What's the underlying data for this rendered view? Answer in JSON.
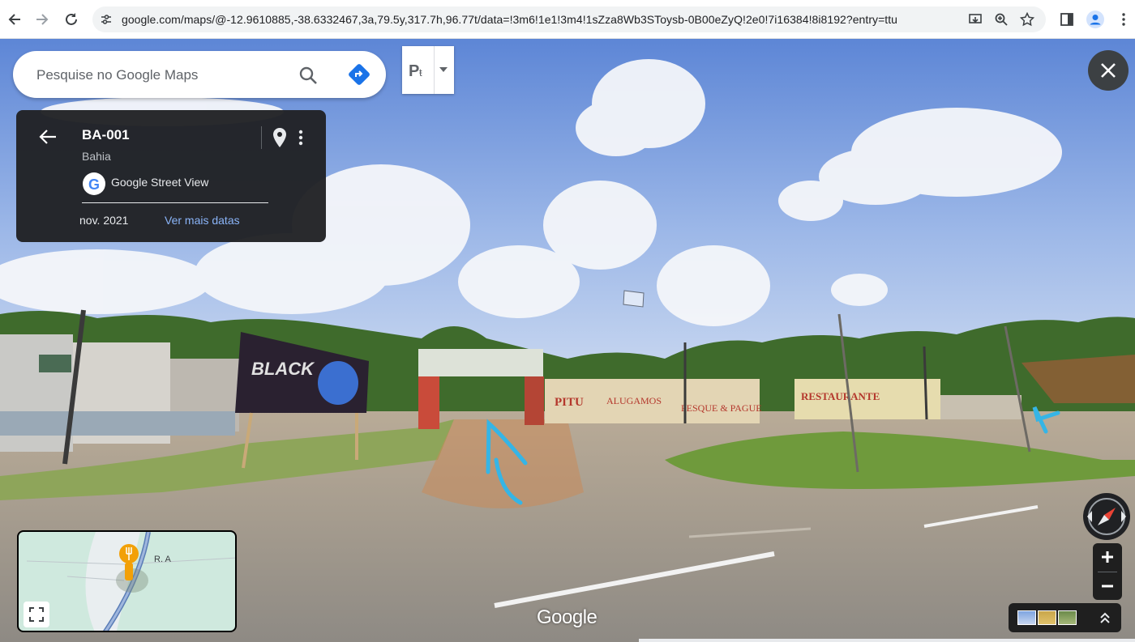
{
  "browser": {
    "url": "google.com/maps/@-12.9610885,-38.6332467,3a,79.5y,317.7h,96.77t/data=!3m6!1e1!3m4!1sZza8Wb3SToysb-0B00eZyQ!2e0!7i16384!8i8192?entry=ttu",
    "back_icon": "arrow-left-icon",
    "forward_icon": "arrow-right-icon",
    "reload_icon": "reload-icon"
  },
  "search": {
    "placeholder": "Pesquise no Google Maps"
  },
  "info_card": {
    "title": "BA-001",
    "subtitle": "Bahia",
    "source": "Google Street View",
    "date": "nov. 2021",
    "more_dates": "Ver mais datas"
  },
  "minimap": {
    "road_label": "R. A"
  },
  "watermark": "Google",
  "colors": {
    "accent_blue": "#1a73e8",
    "link_blue": "#8ab4f8",
    "card_bg": "#202124",
    "pin_orange": "#f2a008"
  }
}
